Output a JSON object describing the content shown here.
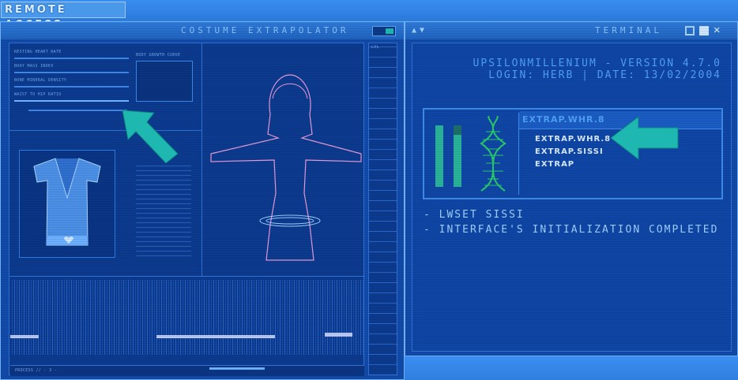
{
  "app": {
    "remote_access_label": "REMOTE ACCESS"
  },
  "extrapolator": {
    "title": "COSTUME EXTRAPOLATOR",
    "stats": [
      {
        "label": "RESTING HEART RATE"
      },
      {
        "label": "BODY MASS INDEX"
      },
      {
        "label": "BONE MINERAL DENSITY"
      },
      {
        "label": "WAIST TO HIP RATIO"
      }
    ],
    "body_growth_label": "BODY GROWTH CURVE",
    "footer_label": "PROCESS // - 3 -"
  },
  "terminal": {
    "title": "TERMINAL",
    "header_line1": "UPSILONMILLENIUM - VERSION 4.7.0",
    "header_line2": "LOGIN: HERB | DATE: 13/02/2004",
    "selected_item": "EXTRAP.WHR.8",
    "items": [
      "EXTRAP.WHR.8",
      "EXTRAP.SISSI",
      "EXTRAP"
    ],
    "log": [
      "- LWSET SISSI",
      "- INTERFACE'S INITIALIZATION COMPLETED"
    ]
  },
  "colors": {
    "accent_arrow": "#1fb8b0",
    "dna_green": "#29c96a",
    "bg": "#2f7fe0"
  }
}
